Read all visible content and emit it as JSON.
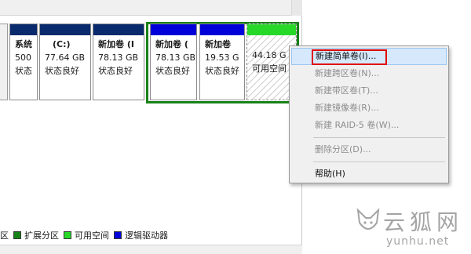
{
  "partitions": [
    {
      "name": "系统",
      "size": "500",
      "status": "状态"
    },
    {
      "name": "(C:)",
      "size": "77.64 GB",
      "status": "状态良好"
    },
    {
      "name": "新加卷  (I",
      "size": "78.13 GB",
      "status": "状态良好"
    },
    {
      "name": "新加卷  (",
      "size": "78.13 GB",
      "status": "状态良好"
    },
    {
      "name": "新加卷",
      "size": "19.53 G",
      "status": "状态良好"
    },
    {
      "name": "",
      "size": "44.18 G",
      "status": "可用空间"
    }
  ],
  "context_menu": {
    "items": [
      {
        "label": "新建简单卷(I)...",
        "enabled": true
      },
      {
        "label": "新建跨区卷(N)...",
        "enabled": false
      },
      {
        "label": "新建带区卷(T)...",
        "enabled": false
      },
      {
        "label": "新建镜像卷(R)...",
        "enabled": false
      },
      {
        "label": "新建 RAID-5 卷(W)...",
        "enabled": false
      },
      {
        "label": "删除分区(D)...",
        "enabled": false
      },
      {
        "label": "帮助(H)",
        "enabled": true
      }
    ]
  },
  "legend": {
    "items": [
      {
        "label": "区",
        "color": null
      },
      {
        "label": "扩展分区",
        "color": "#178217"
      },
      {
        "label": "可用空间",
        "color": "#28d828"
      },
      {
        "label": "逻辑驱动器",
        "color": "#0000d8"
      }
    ]
  },
  "watermark": {
    "name": "云狐网",
    "url": "yunhu.net"
  }
}
